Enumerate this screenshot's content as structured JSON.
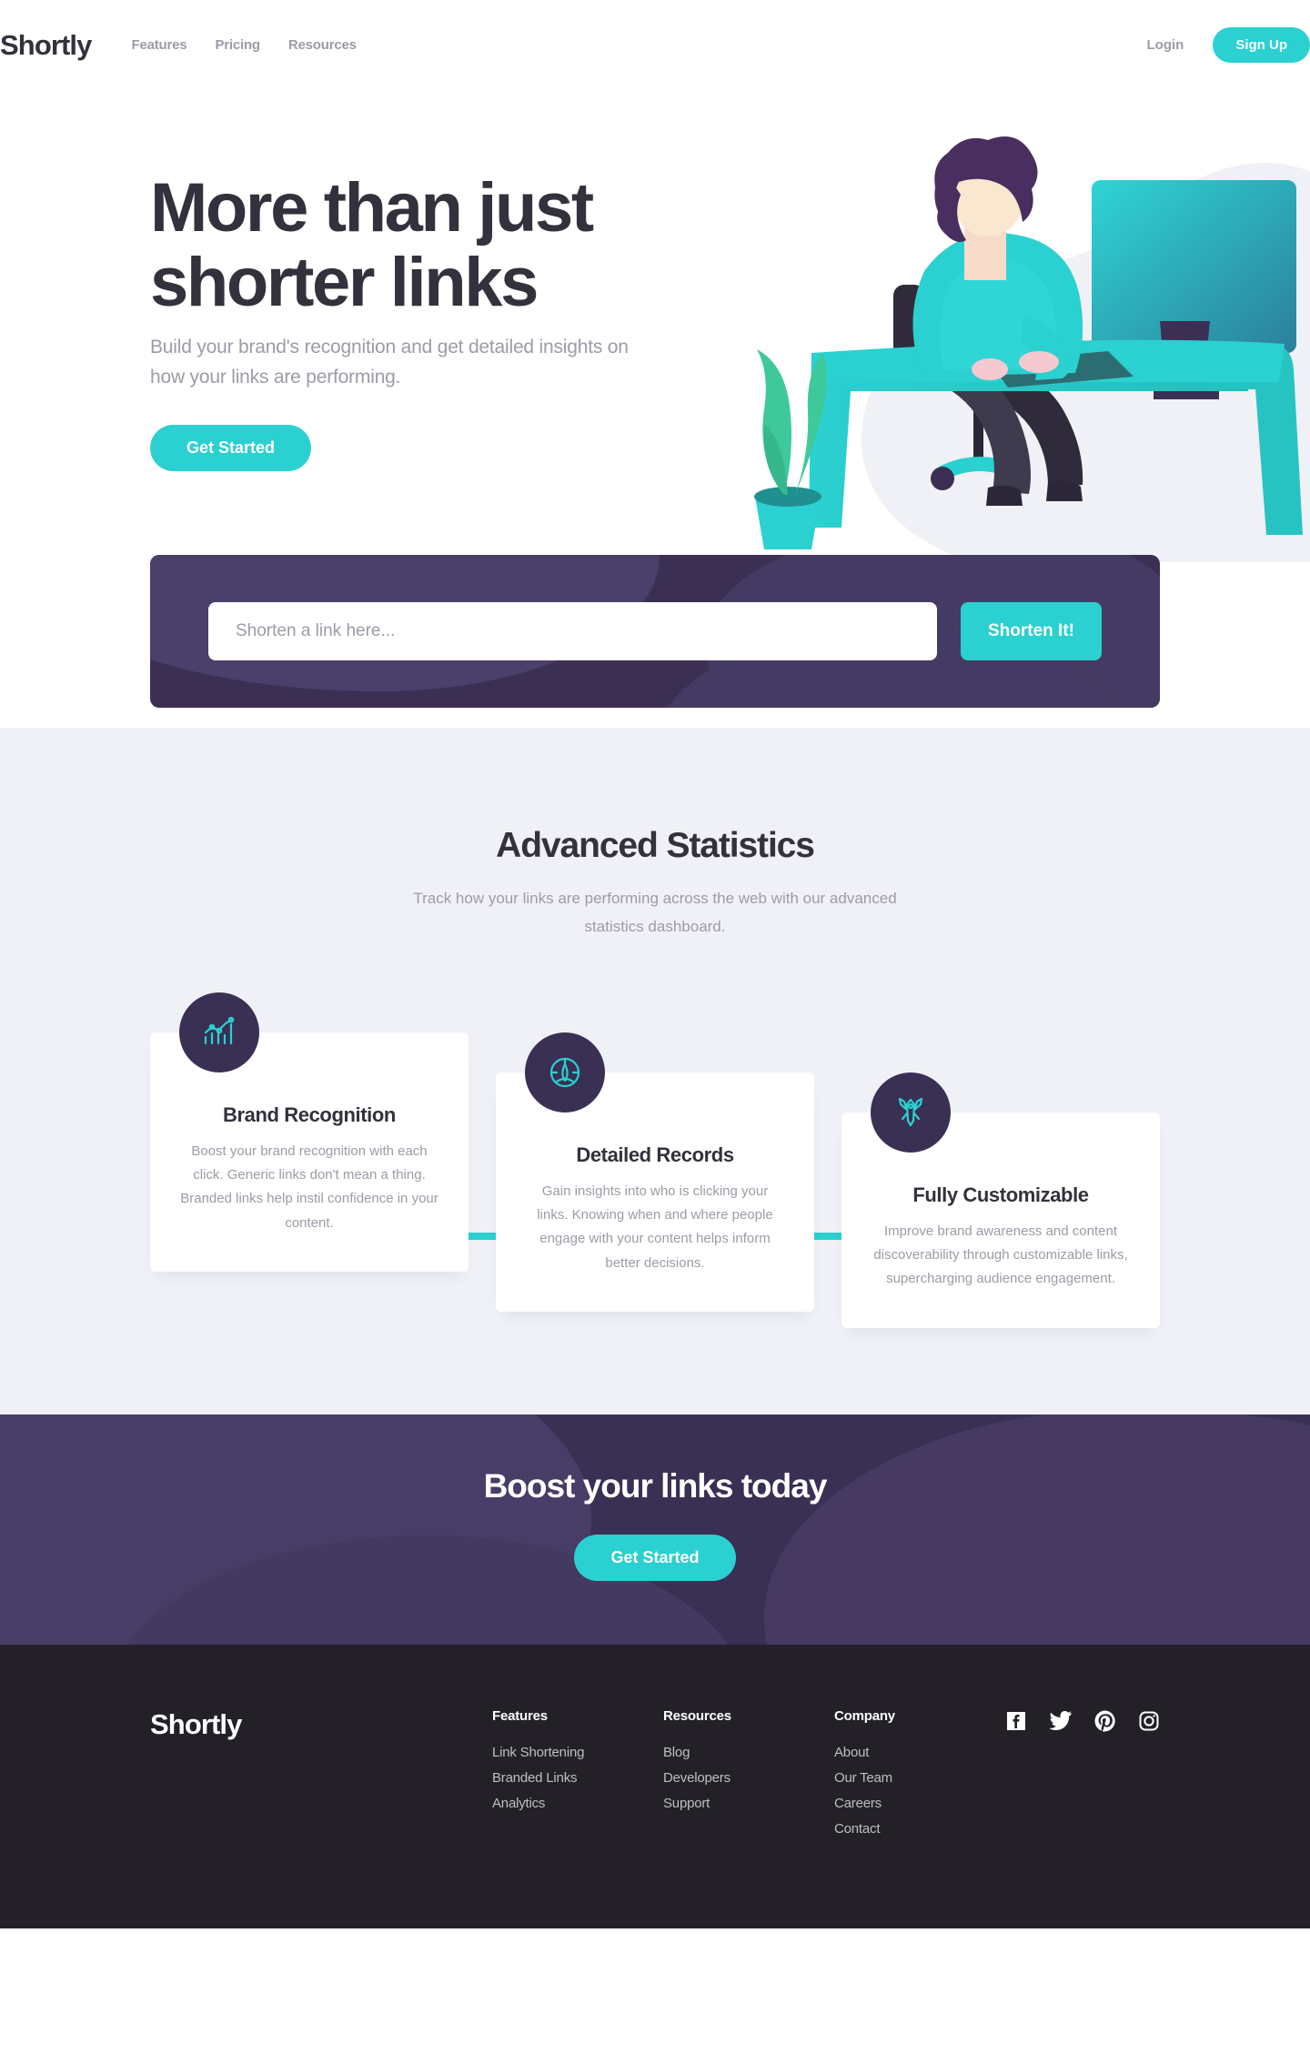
{
  "brand": {
    "name": "Shortly"
  },
  "header": {
    "nav": [
      {
        "label": "Features"
      },
      {
        "label": "Pricing"
      },
      {
        "label": "Resources"
      }
    ],
    "login_label": "Login",
    "signup_label": "Sign Up"
  },
  "hero": {
    "title_line1": "More than just",
    "title_line2": "shorter links",
    "subtitle": "Build your brand's recognition and get detailed insights on how your links are performing.",
    "cta_label": "Get Started"
  },
  "shorten": {
    "placeholder": "Shorten a link here...",
    "value": "",
    "button_label": "Shorten It!"
  },
  "statistics": {
    "title": "Advanced Statistics",
    "subtitle": "Track how your links are performing across the web with our advanced statistics dashboard.",
    "cards": [
      {
        "icon": "brand-recognition-icon",
        "title": "Brand Recognition",
        "body": "Boost your brand recognition with each click. Generic links don't mean a thing. Branded links help instil confidence in your content."
      },
      {
        "icon": "detailed-records-icon",
        "title": "Detailed Records",
        "body": "Gain insights into who is clicking your links. Knowing when and where people engage with your content helps inform better decisions."
      },
      {
        "icon": "fully-customizable-icon",
        "title": "Fully Customizable",
        "body": "Improve brand awareness and content discoverability through customizable links, supercharging audience engagement."
      }
    ]
  },
  "boost": {
    "title": "Boost your links today",
    "cta_label": "Get Started"
  },
  "footer": {
    "logo": "Shortly",
    "columns": [
      {
        "heading": "Features",
        "links": [
          {
            "label": "Link Shortening"
          },
          {
            "label": "Branded Links"
          },
          {
            "label": "Analytics"
          }
        ]
      },
      {
        "heading": "Resources",
        "links": [
          {
            "label": "Blog"
          },
          {
            "label": "Developers"
          },
          {
            "label": "Support"
          }
        ]
      },
      {
        "heading": "Company",
        "links": [
          {
            "label": "About"
          },
          {
            "label": "Our Team"
          },
          {
            "label": "Careers"
          },
          {
            "label": "Contact"
          }
        ]
      }
    ],
    "socials": [
      {
        "icon": "facebook-icon",
        "label": "Facebook"
      },
      {
        "icon": "twitter-icon",
        "label": "Twitter"
      },
      {
        "icon": "pinterest-icon",
        "label": "Pinterest"
      },
      {
        "icon": "instagram-icon",
        "label": "Instagram"
      }
    ]
  },
  "colors": {
    "cyan": "#2bd0d0",
    "dark_violet": "#3a3054",
    "very_dark_blue": "#34313d",
    "grayish_violet": "#9e9aa7",
    "light_gray_bg": "#eff1f7",
    "footer_bg": "#232127"
  }
}
